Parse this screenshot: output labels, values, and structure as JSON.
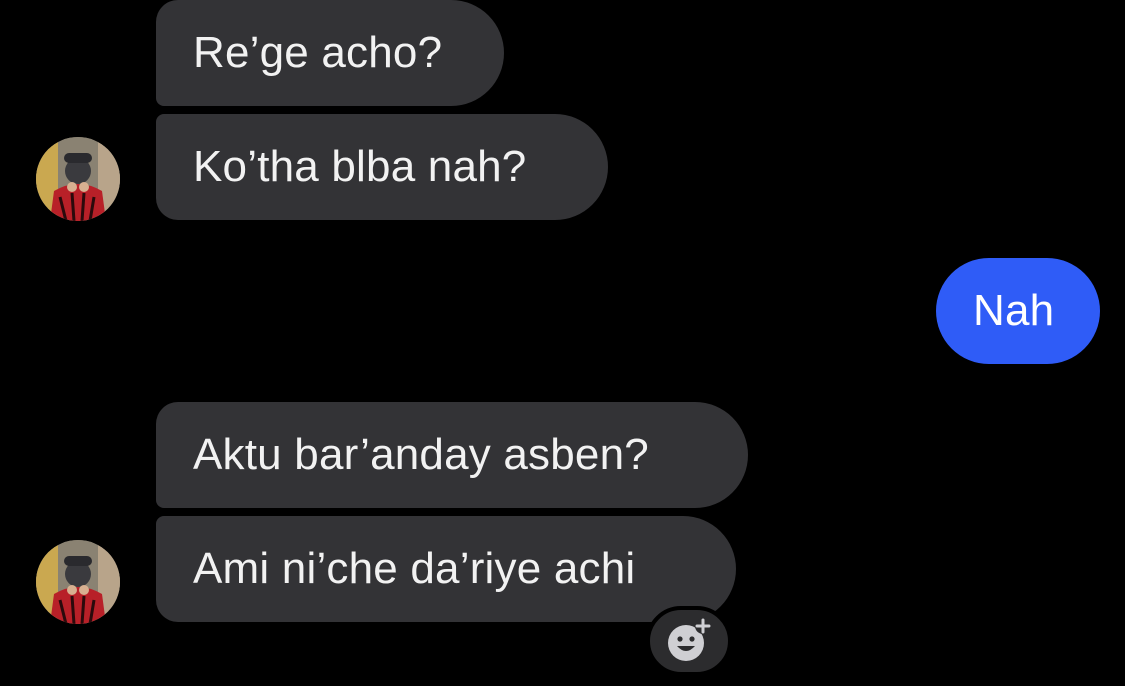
{
  "conversation": {
    "messages": [
      {
        "sender": "them",
        "text": "Re’ge acho?"
      },
      {
        "sender": "them",
        "text": "Ko’tha blba nah?"
      },
      {
        "sender": "me",
        "text": "Nah"
      },
      {
        "sender": "them",
        "text": "Aktu bar’anday asben?"
      },
      {
        "sender": "them",
        "text": "Ami ni’che da’riye achi"
      }
    ]
  },
  "icons": {
    "avatar": "contact-avatar",
    "reaction": "add-reaction-icon"
  },
  "colors": {
    "background": "#000000",
    "incoming_bubble": "#333336",
    "outgoing_bubble": "#2f5cf7",
    "text": "#f2f2f2"
  }
}
